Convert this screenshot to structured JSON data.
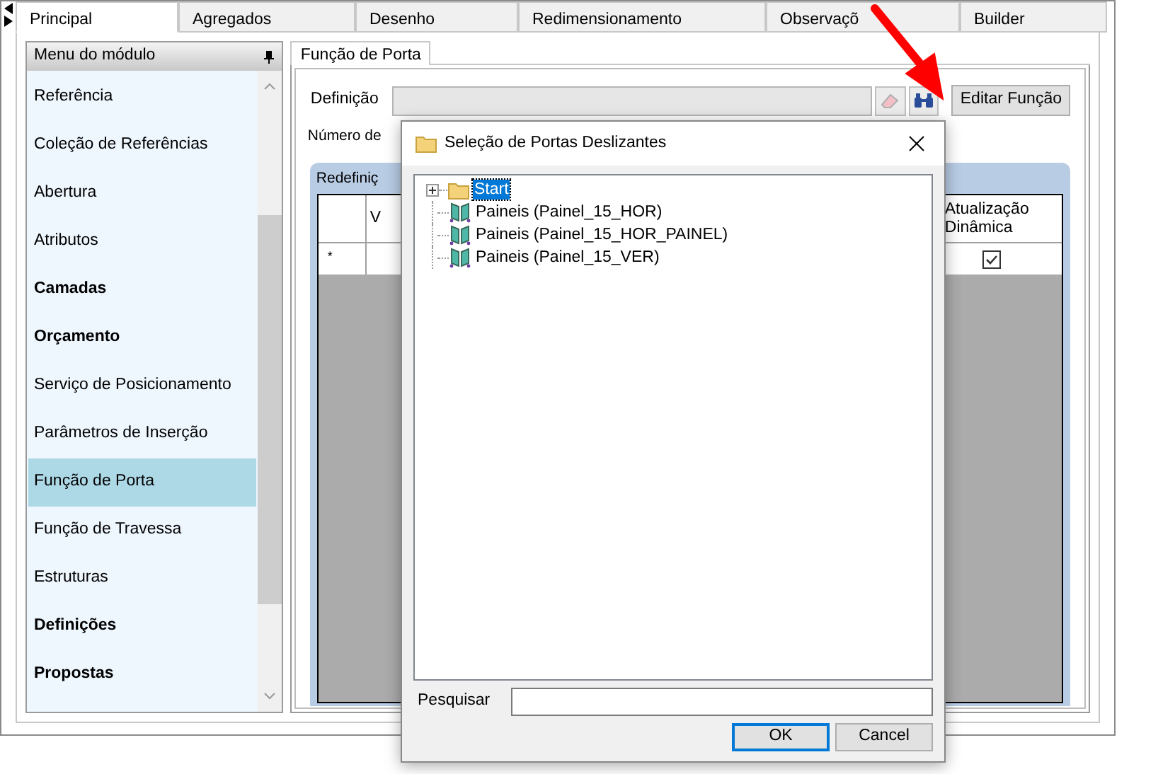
{
  "tabs": [
    {
      "label": "Principal",
      "selected": true
    },
    {
      "label": "Agregados",
      "selected": false
    },
    {
      "label": "Desenho",
      "selected": false
    },
    {
      "label": "Redimensionamento",
      "selected": false
    },
    {
      "label": "Observaçõ",
      "selected": false
    },
    {
      "label": "Builder",
      "selected": false
    }
  ],
  "sidebar": {
    "title": "Menu do módulo",
    "items": [
      {
        "label": "Referência",
        "bold": false,
        "selected": false
      },
      {
        "label": "Coleção de Referências",
        "bold": false,
        "selected": false
      },
      {
        "label": "Abertura",
        "bold": false,
        "selected": false
      },
      {
        "label": "Atributos",
        "bold": false,
        "selected": false
      },
      {
        "label": "Camadas",
        "bold": true,
        "selected": false
      },
      {
        "label": "Orçamento",
        "bold": true,
        "selected": false
      },
      {
        "label": "Serviço de Posicionamento",
        "bold": false,
        "selected": false
      },
      {
        "label": "Parâmetros de Inserção",
        "bold": false,
        "selected": false
      },
      {
        "label": "Função de Porta",
        "bold": false,
        "selected": true
      },
      {
        "label": "Função de Travessa",
        "bold": false,
        "selected": false
      },
      {
        "label": "Estruturas",
        "bold": false,
        "selected": false
      },
      {
        "label": "Definições",
        "bold": true,
        "selected": false
      },
      {
        "label": "Propostas",
        "bold": true,
        "selected": false
      }
    ]
  },
  "panel": {
    "tab": "Função de Porta",
    "definition_label": "Definição",
    "edit_button": "Editar Função",
    "number_label": "Número de",
    "group_title": "Redefiniç",
    "table": {
      "columns": [
        "V",
        "Atualização Dinâmica"
      ],
      "new_row": {
        "marker": "*",
        "checked": true
      }
    }
  },
  "dialog": {
    "title": "Seleção de Portas Deslizantes",
    "tree": [
      {
        "label": "Start",
        "kind": "folder",
        "expanded": false,
        "selected": true
      },
      {
        "label": "Paineis (Painel_15_HOR)",
        "kind": "panel",
        "selected": false
      },
      {
        "label": "Paineis (Painel_15_HOR_PAINEL)",
        "kind": "panel",
        "selected": false
      },
      {
        "label": "Paineis (Painel_15_VER)",
        "kind": "panel",
        "selected": false
      }
    ],
    "search_label": "Pesquisar",
    "buttons": [
      {
        "label": "OK",
        "default": true
      },
      {
        "label": "Cancel",
        "default": false
      }
    ]
  }
}
